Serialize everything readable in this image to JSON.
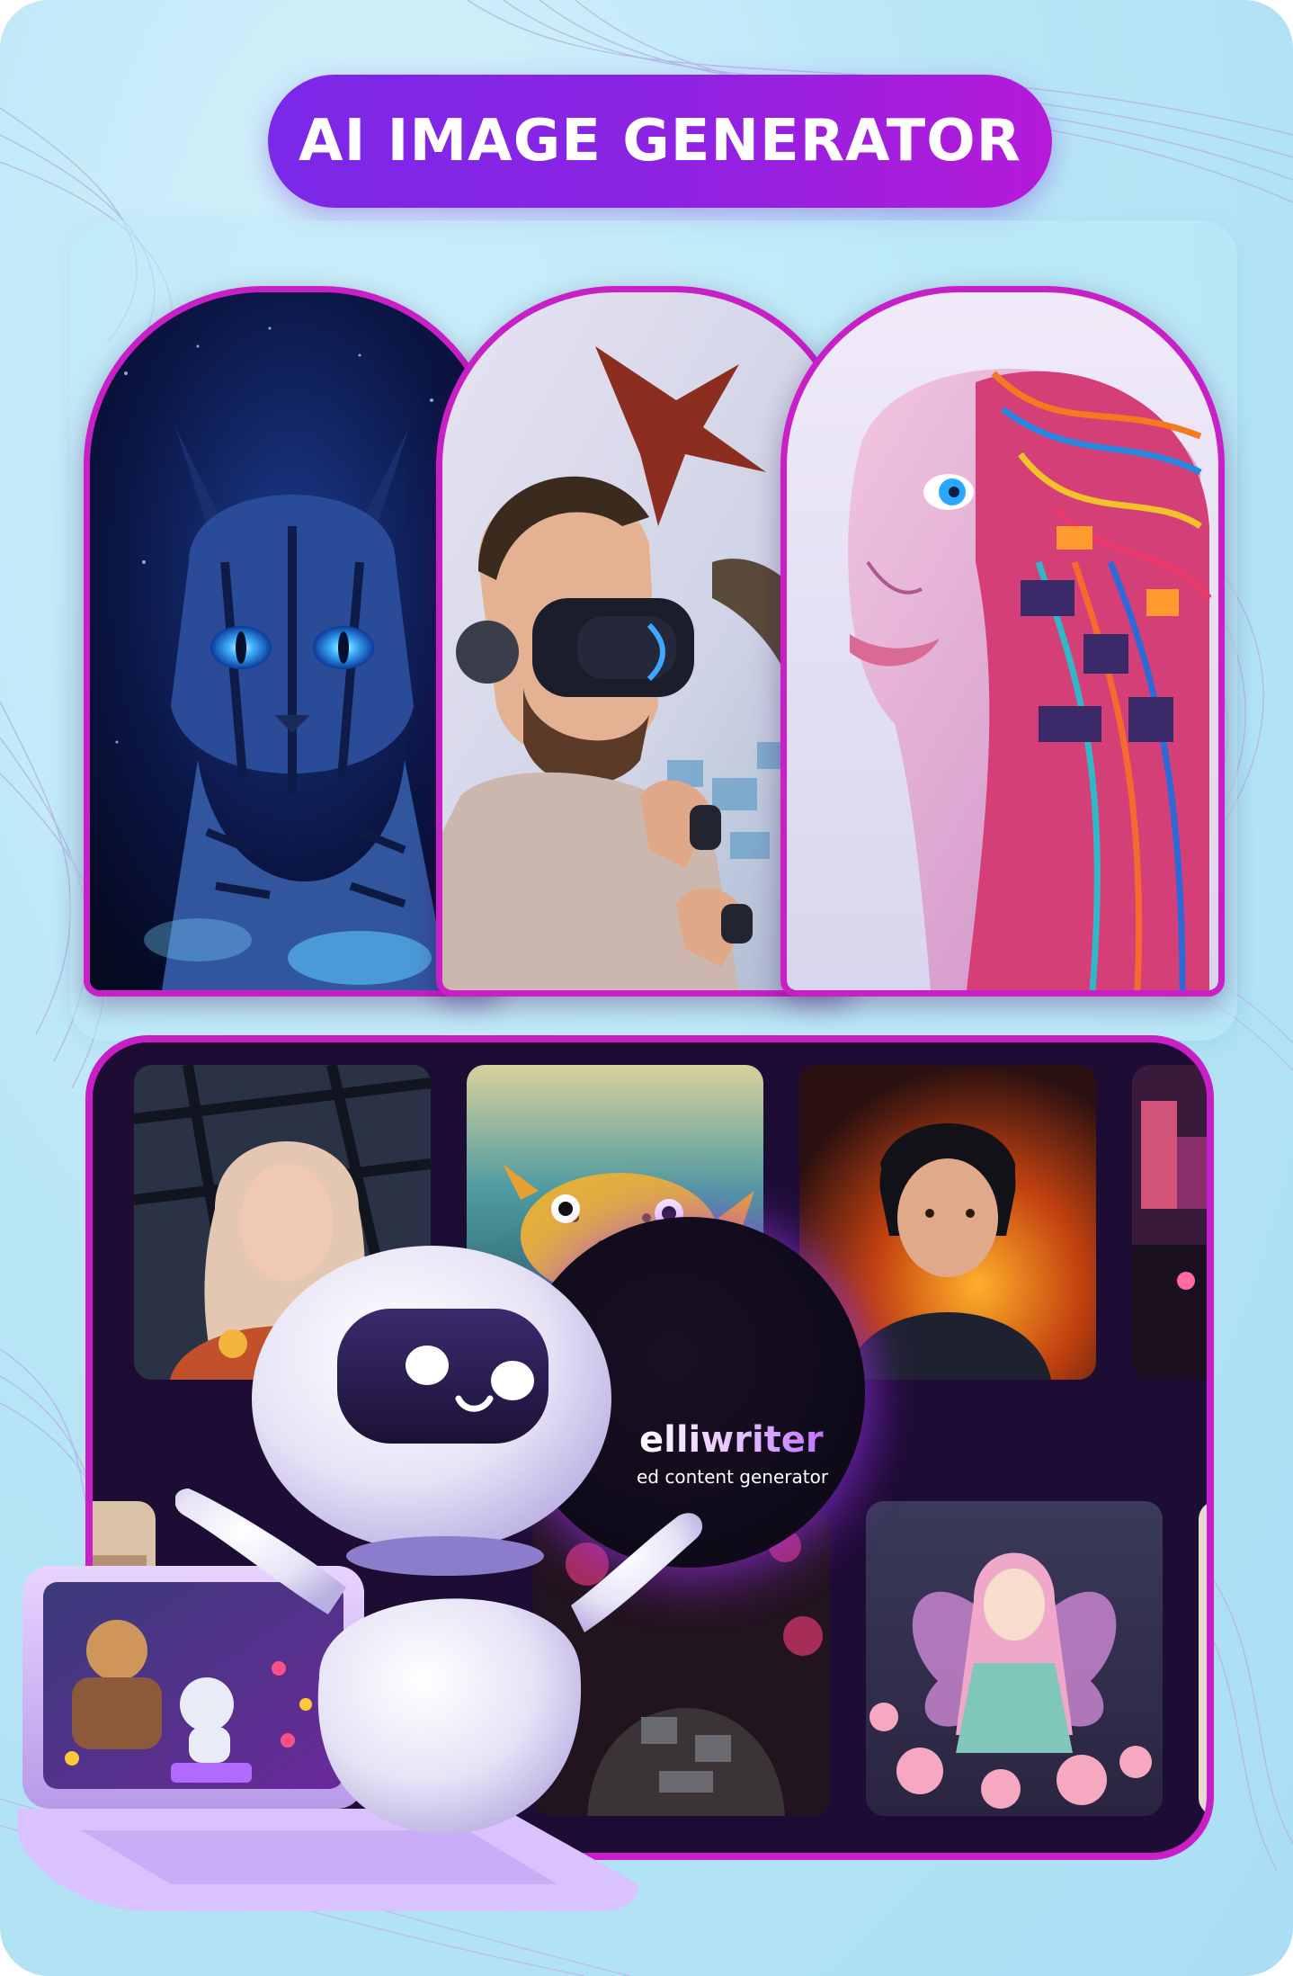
{
  "header": {
    "title": "AI IMAGE GENERATOR"
  },
  "brand": {
    "name": "elliwriter",
    "tagline": "ed content generator"
  },
  "colors": {
    "accent_purple": "#7b28e8",
    "accent_magenta": "#c81fc6",
    "gallery_bg": "#1d0c34",
    "page_bg": "#b9e6f6"
  },
  "showcase": [
    {
      "subject": "glowing blue cat"
    },
    {
      "subject": "man wearing VR headset with dragons"
    },
    {
      "subject": "cyborg woman with circuitry"
    }
  ],
  "gallery": [
    {
      "subject": "girl with curly hair"
    },
    {
      "subject": "pufferfish underwater"
    },
    {
      "subject": "boy with fire background"
    },
    {
      "subject": "neon city street"
    },
    {
      "subject": "portrait"
    },
    {
      "subject": "neon armored figure"
    },
    {
      "subject": "anime fairy with wings"
    },
    {
      "subject": "partial image"
    }
  ],
  "mascot": {
    "name": "robot-mascot"
  },
  "device": {
    "name": "laptop"
  }
}
